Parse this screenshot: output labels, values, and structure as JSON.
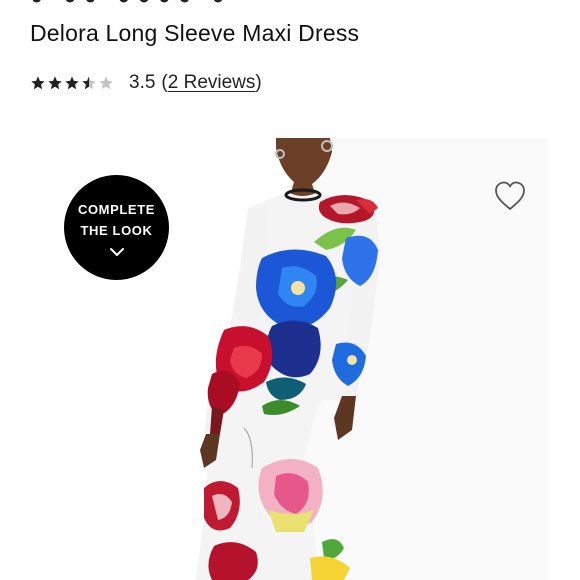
{
  "product": {
    "title": "Delora Long Sleeve Maxi Dress"
  },
  "rating": {
    "value": "3.5",
    "stars": 3.5,
    "stars_max": 5,
    "open_paren": "(",
    "reviews_label": "2 Reviews",
    "close_paren": ")"
  },
  "badge": {
    "line1": "COMPLETE",
    "line2": "THE LOOK",
    "icon": "chevron-down-icon"
  },
  "wishlist": {
    "icon": "heart-icon"
  },
  "colors": {
    "text": "#1a1a1a",
    "star_filled": "#222222",
    "star_empty": "#c4c4c4",
    "badge_bg": "#000000",
    "badge_text": "#ffffff",
    "heart_stroke": "#555555"
  }
}
